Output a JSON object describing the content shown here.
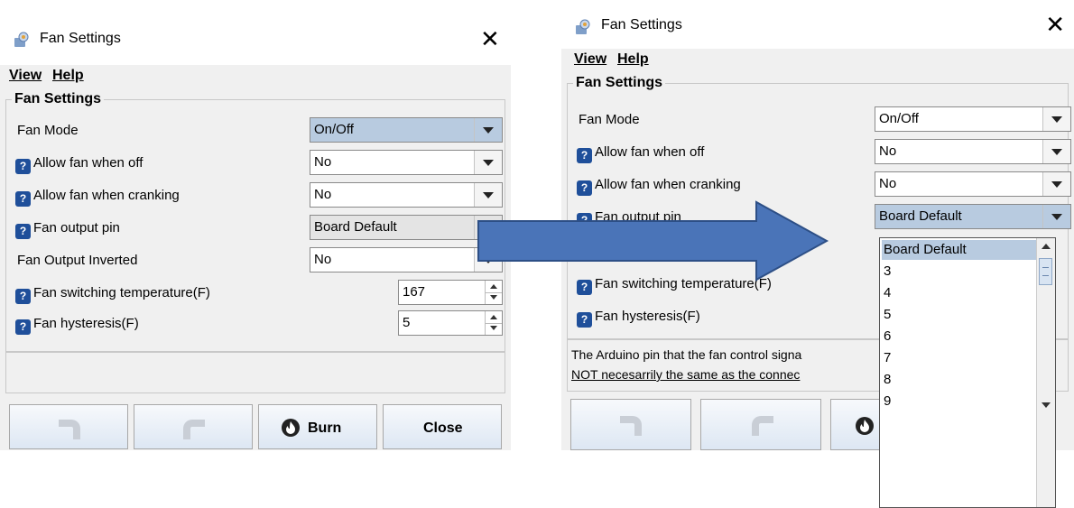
{
  "colors": {
    "arrow_fill": "#4a74b8",
    "arrow_stroke": "#2d4f86",
    "help_icon": "#1f4f9a",
    "selected_bg": "#b8cbe0"
  },
  "left": {
    "title": "Fan Settings",
    "menu": {
      "view": "View",
      "help": "Help"
    },
    "group_title": "Fan Settings",
    "rows": [
      {
        "label": "Fan Mode",
        "value": "On/Off"
      },
      {
        "label": "Allow fan when off",
        "value": "No"
      },
      {
        "label": "Allow fan when cranking",
        "value": "No"
      },
      {
        "label": "Fan output pin",
        "value": "Board Default"
      },
      {
        "label": "Fan Output Inverted",
        "value": "No"
      },
      {
        "label": "Fan switching temperature(F)",
        "value": "167"
      },
      {
        "label": "Fan hysteresis(F)",
        "value": "5"
      }
    ],
    "buttons": {
      "burn": "Burn",
      "close": "Close"
    }
  },
  "right": {
    "title": "Fan Settings",
    "menu": {
      "view": "View",
      "help": "Help"
    },
    "group_title": "Fan Settings",
    "rows": [
      {
        "label": "Fan Mode",
        "value": "On/Off"
      },
      {
        "label": "Allow fan when off",
        "value": "No"
      },
      {
        "label": "Allow fan when cranking",
        "value": "No"
      },
      {
        "label": "Fan output pin",
        "value": "Board Default"
      },
      {
        "label": "Fan switching temperature(F)"
      },
      {
        "label": "Fan hysteresis(F)"
      }
    ],
    "description": [
      "The Arduino pin that the fan control signa",
      "NOT necesarrily the same as the connec"
    ],
    "dropdown_options": [
      "Board Default",
      "3",
      "4",
      "5",
      "6",
      "7",
      "8",
      "9"
    ]
  }
}
